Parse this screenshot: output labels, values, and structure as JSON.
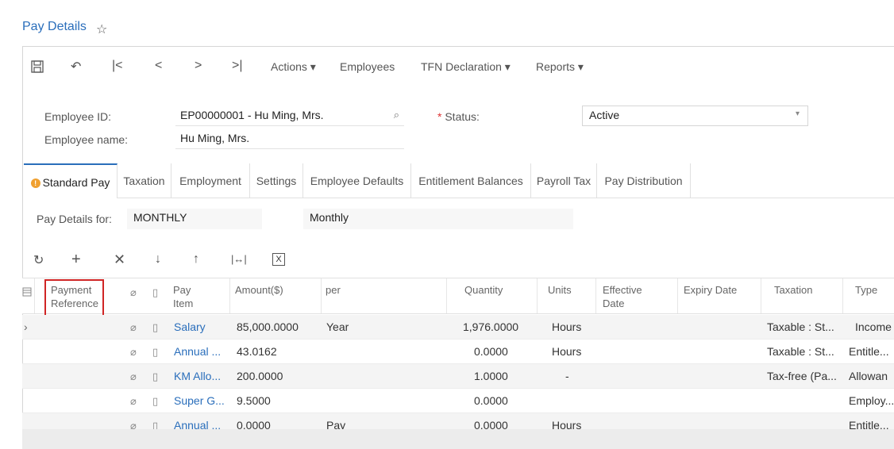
{
  "page": {
    "title": "Pay Details"
  },
  "toolbar": {
    "actions": "Actions",
    "employees": "Employees",
    "tfn_declaration": "TFN Declaration",
    "reports": "Reports"
  },
  "form": {
    "employee_id_label": "Employee ID:",
    "employee_id_value": "EP00000001 - Hu Ming, Mrs.",
    "employee_name_label": "Employee name:",
    "employee_name_value": "Hu Ming, Mrs.",
    "status_label": "Status:",
    "status_value": "Active"
  },
  "tabs": [
    {
      "label": "Standard Pay"
    },
    {
      "label": "Taxation"
    },
    {
      "label": "Employment"
    },
    {
      "label": "Settings"
    },
    {
      "label": "Employee Defaults"
    },
    {
      "label": "Entitlement Balances"
    },
    {
      "label": "Payroll Tax"
    },
    {
      "label": "Pay Distribution"
    }
  ],
  "pay_details": {
    "label": "Pay Details for:",
    "code": "MONTHLY",
    "description": "Monthly"
  },
  "grid": {
    "columns": {
      "payment_ref_1": "Payment",
      "payment_ref_2": "Reference",
      "pay_item_1": "Pay",
      "pay_item_2": "Item",
      "amount": "Amount($)",
      "per": "per",
      "quantity": "Quantity",
      "units": "Units",
      "effective_1": "Effective",
      "effective_2": "Date",
      "expiry": "Expiry Date",
      "taxation": "Taxation",
      "type": "Type"
    },
    "rows": [
      {
        "pay_item": "Salary",
        "amount": "85,000.0000",
        "per": "Year",
        "quantity": "1,976.0000",
        "units": "Hours",
        "taxation": "Taxable : St...",
        "type": "Income"
      },
      {
        "pay_item": "Annual ...",
        "amount": "43.0162",
        "per": "",
        "quantity": "0.0000",
        "units": "Hours",
        "taxation": "Taxable : St...",
        "type": "Entitle..."
      },
      {
        "pay_item": "KM Allo...",
        "amount": "200.0000",
        "per": "",
        "quantity": "1.0000",
        "units": "-",
        "taxation": "Tax-free (Pa...",
        "type": "Allowan"
      },
      {
        "pay_item": "Super G...",
        "amount": "9.5000",
        "per": "",
        "quantity": "0.0000",
        "units": "",
        "taxation": "",
        "type": "Employ..."
      },
      {
        "pay_item": "Annual ...",
        "amount": "0.0000",
        "per": "Pay",
        "quantity": "0.0000",
        "units": "Hours",
        "taxation": "",
        "type": "Entitle..."
      }
    ]
  }
}
